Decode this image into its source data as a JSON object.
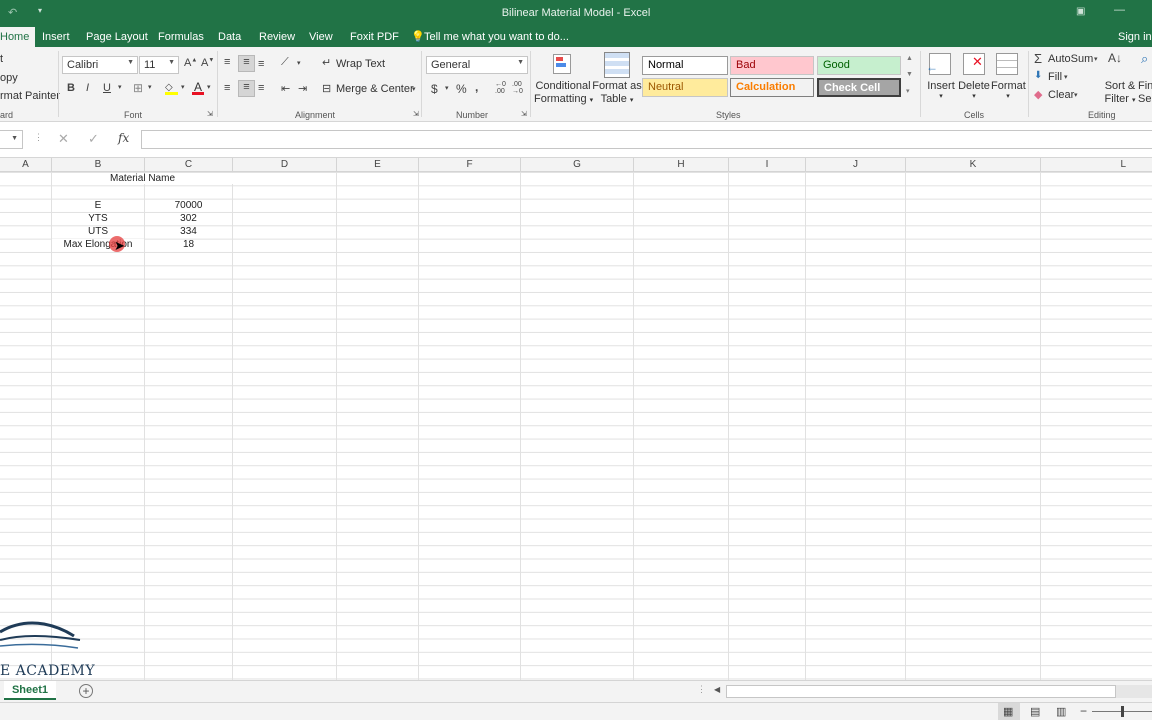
{
  "window": {
    "title": "Bilinear Material Model - Excel"
  },
  "tabs": [
    "Home",
    "Insert",
    "Page Layout",
    "Formulas",
    "Data",
    "Review",
    "View",
    "Foxit PDF"
  ],
  "tell_me": "Tell me what you want to do...",
  "sign_in": "Sign in",
  "clipboard": {
    "cut": "t",
    "copy": "opy",
    "format_painter": "rmat Painter",
    "label": "ard"
  },
  "font": {
    "name": "Calibri",
    "size": "11",
    "label": "Font",
    "bold": "B",
    "italic": "I",
    "underline": "U"
  },
  "alignment": {
    "wrap_text": "Wrap Text",
    "merge_center": "Merge & Center",
    "label": "Alignment"
  },
  "number": {
    "format": "General",
    "currency": "$",
    "percent": "%",
    "comma": ",",
    "label": "Number"
  },
  "styles": {
    "conditional_formatting": [
      "Conditional",
      "Formatting"
    ],
    "format_as_table": [
      "Format as",
      "Table"
    ],
    "normal": "Normal",
    "bad": "Bad",
    "good": "Good",
    "neutral": "Neutral",
    "calculation": "Calculation",
    "check_cell": "Check Cell",
    "label": "Styles"
  },
  "cells_group": {
    "insert": "Insert",
    "delete": "Delete",
    "format": "Format",
    "label": "Cells"
  },
  "editing": {
    "autosum": "AutoSum",
    "fill": "Fill",
    "clear": "Clear",
    "sort_filter": [
      "Sort &",
      "Filter"
    ],
    "find": [
      "Fin",
      "Sele"
    ],
    "label": "Editing"
  },
  "formula_bar": {
    "fx": "fx",
    "cancel": "✕",
    "enter": "✓",
    "value": ""
  },
  "columns": [
    "A",
    "B",
    "C",
    "D",
    "E",
    "F",
    "G",
    "H",
    "I",
    "J",
    "K",
    "L"
  ],
  "sheet": {
    "title": "Material Name",
    "rows": [
      {
        "label": "E",
        "value": "70000"
      },
      {
        "label": "YTS",
        "value": "302"
      },
      {
        "label": "UTS",
        "value": "334"
      },
      {
        "label": "Max Elongation",
        "value": "18"
      }
    ]
  },
  "sheet_tabs": [
    "Sheet1"
  ],
  "watermark": "E ACADEMY",
  "colors": {
    "excel_green": "#217346",
    "bad_bg": "#ffc7ce",
    "bad_fg": "#9c0006",
    "good_bg": "#c6efce",
    "good_fg": "#006100",
    "neutral_bg": "#ffeb9c",
    "neutral_fg": "#9c5700",
    "calc_fg": "#fa7d00",
    "check_bg": "#a5a5a5"
  }
}
